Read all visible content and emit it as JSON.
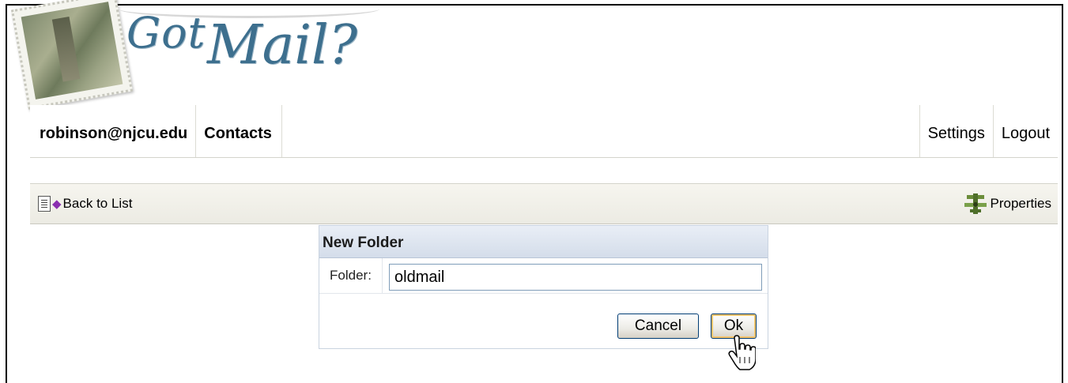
{
  "logo": {
    "text_part1": "Got",
    "text_part2": "Mail?"
  },
  "topnav": {
    "left_items": [
      {
        "label": "robinson@njcu.edu"
      },
      {
        "label": "Contacts"
      }
    ],
    "right_items": [
      {
        "label": "Settings"
      },
      {
        "label": "Logout"
      }
    ]
  },
  "toolbar": {
    "back_label": "Back to List",
    "properties_label": "Properties"
  },
  "dialog": {
    "title": "New Folder",
    "field_label": "Folder:",
    "field_value": "oldmail",
    "cancel_label": "Cancel",
    "ok_label": "Ok"
  },
  "icons": [
    "list-icon",
    "back-arrow-icon",
    "properties-icon",
    "hand-cursor-icon",
    "stamp-logo"
  ],
  "colors": {
    "logo": "#3d6f8e",
    "toolbar_bg": "#f0efe8",
    "dialog_header": "#dbe3ee",
    "button_border": "#003c74",
    "ok_focus": "#f5c36a"
  }
}
